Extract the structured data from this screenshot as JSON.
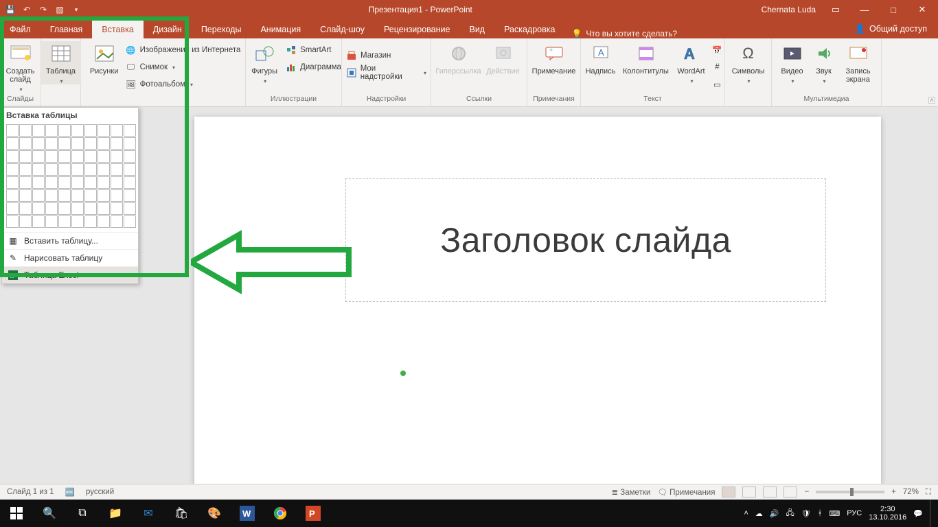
{
  "title": "Презентация1 - PowerPoint",
  "user": "Chernata Luda",
  "tabs": [
    "Файл",
    "Главная",
    "Вставка",
    "Дизайн",
    "Переходы",
    "Анимация",
    "Слайд-шоу",
    "Рецензирование",
    "Вид",
    "Раскадровка"
  ],
  "active_tab_index": 2,
  "tellme": "Что вы хотите сделать?",
  "share": "Общий доступ",
  "ribbon": {
    "slides": {
      "new_slide": "Создать слайд",
      "group": "Слайды"
    },
    "table": {
      "btn": "Таблица"
    },
    "images": {
      "pictures": "Рисунки",
      "online": "Изображения из Интернета",
      "screenshot": "Снимок",
      "album": "Фотоальбом"
    },
    "illus": {
      "shapes": "Фигуры",
      "smartart": "SmartArt",
      "chart": "Диаграмма",
      "group": "Иллюстрации"
    },
    "addins": {
      "store": "Магазин",
      "myaddins": "Мои надстройки",
      "group": "Надстройки"
    },
    "links": {
      "hyperlink": "Гиперссылка",
      "action": "Действие",
      "group": "Ссылки"
    },
    "comments": {
      "comment": "Примечание",
      "group": "Примечания"
    },
    "text": {
      "textbox": "Надпись",
      "headerfooter": "Колонтитулы",
      "wordart": "WordArt",
      "group": "Текст"
    },
    "symbols": {
      "symbols": "Символы"
    },
    "media": {
      "video": "Видео",
      "audio": "Звук",
      "screenrec": "Запись экрана",
      "group": "Мультимедиа"
    }
  },
  "table_dd": {
    "header": "Вставка таблицы",
    "insert": "Вставить таблицу...",
    "draw": "Нарисовать таблицу",
    "excel": "Таблица Excel"
  },
  "slide_title_placeholder": "Заголовок слайда",
  "status": {
    "slide": "Слайд 1 из 1",
    "lang": "русский",
    "notes": "Заметки",
    "comments": "Примечания",
    "zoom": "72%"
  },
  "taskbar": {
    "lang": "РУС",
    "time": "2:30",
    "date": "13.10.2016"
  }
}
